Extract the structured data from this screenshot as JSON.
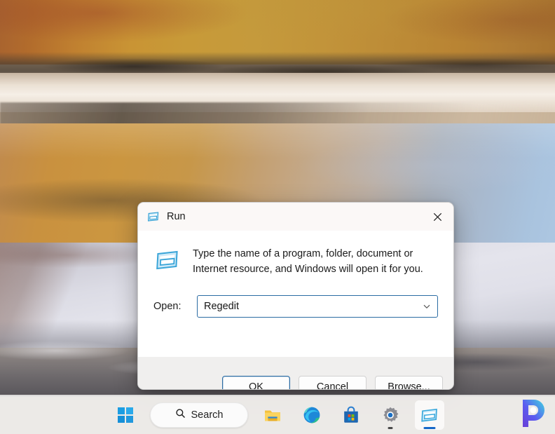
{
  "desktop": {
    "wallpaper_name": "altiplano-lagoon-wallpaper",
    "colors": {
      "hills": "#c4943a",
      "water": "#c79749",
      "salt_flat": "#e0e0e9",
      "sky_blue": "#adc7e2",
      "taskbar": "#eeedec"
    }
  },
  "dialog": {
    "title": "Run",
    "title_icon": "run-window-icon",
    "close_icon": "close-icon",
    "body_icon": "run-window-icon",
    "description": "Type the name of a program, folder, document or Internet resource, and Windows will open it for you.",
    "open_label": "Open:",
    "open_value": "Regedit",
    "open_placeholder": "",
    "dropdown_icon": "chevron-down-icon",
    "accent_color": "#2b6ca3",
    "buttons": [
      {
        "label": "OK",
        "name": "ok-button",
        "focused": true
      },
      {
        "label": "Cancel",
        "name": "cancel-button",
        "focused": false
      },
      {
        "label": "Browse...",
        "name": "browse-button",
        "focused": false
      }
    ]
  },
  "taskbar": {
    "start": {
      "label": "Start",
      "icon": "windows-start-icon"
    },
    "search": {
      "label": "Search",
      "icon": "search-icon"
    },
    "items": [
      {
        "label": "File Explorer",
        "icon": "file-explorer-icon",
        "active": false,
        "running": false
      },
      {
        "label": "Microsoft Edge",
        "icon": "edge-icon",
        "active": false,
        "running": false
      },
      {
        "label": "Microsoft Store",
        "icon": "microsoft-store-icon",
        "active": false,
        "running": false
      },
      {
        "label": "Settings",
        "icon": "settings-gear-icon",
        "active": false,
        "running": true
      },
      {
        "label": "Run",
        "icon": "run-window-icon",
        "active": true,
        "running": true
      }
    ]
  },
  "watermark": {
    "label": "P",
    "name": "brand-logo"
  }
}
